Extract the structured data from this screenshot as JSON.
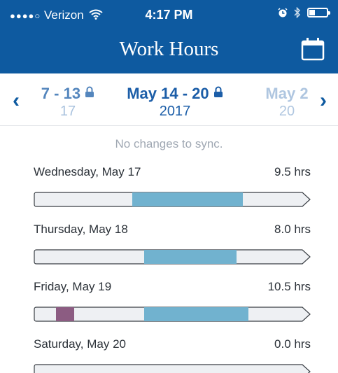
{
  "status_bar": {
    "carrier": "Verizon",
    "signal": "●●●●○",
    "time": "4:17 PM",
    "battery_level": 0.35
  },
  "header": {
    "title": "Work Hours",
    "calendar_icon": "calendar-icon"
  },
  "week_selector": {
    "prev": {
      "range": "7 - 13",
      "year": "17"
    },
    "current": {
      "range": "May 14 - 20",
      "year": "2017"
    },
    "next": {
      "range": "May 2",
      "year": "20"
    }
  },
  "sync_message": "No changes to sync.",
  "days": [
    {
      "label": "Wednesday, May 17",
      "hours": "9.5 hrs",
      "segments": [
        {
          "type": "work",
          "start": 0.355,
          "end": 0.755
        }
      ]
    },
    {
      "label": "Thursday, May 18",
      "hours": "8.0 hrs",
      "segments": [
        {
          "type": "work",
          "start": 0.398,
          "end": 0.733
        }
      ]
    },
    {
      "label": "Friday, May 19",
      "hours": "10.5 hrs",
      "segments": [
        {
          "type": "other",
          "start": 0.082,
          "end": 0.147
        },
        {
          "type": "work",
          "start": 0.398,
          "end": 0.775
        }
      ]
    },
    {
      "label": "Saturday, May 20",
      "hours": "0.0 hrs",
      "segments": []
    }
  ],
  "colors": {
    "header_blue": "#0e5aa0",
    "work_segment": "#71b2cf",
    "other_segment": "#8c5c82"
  }
}
